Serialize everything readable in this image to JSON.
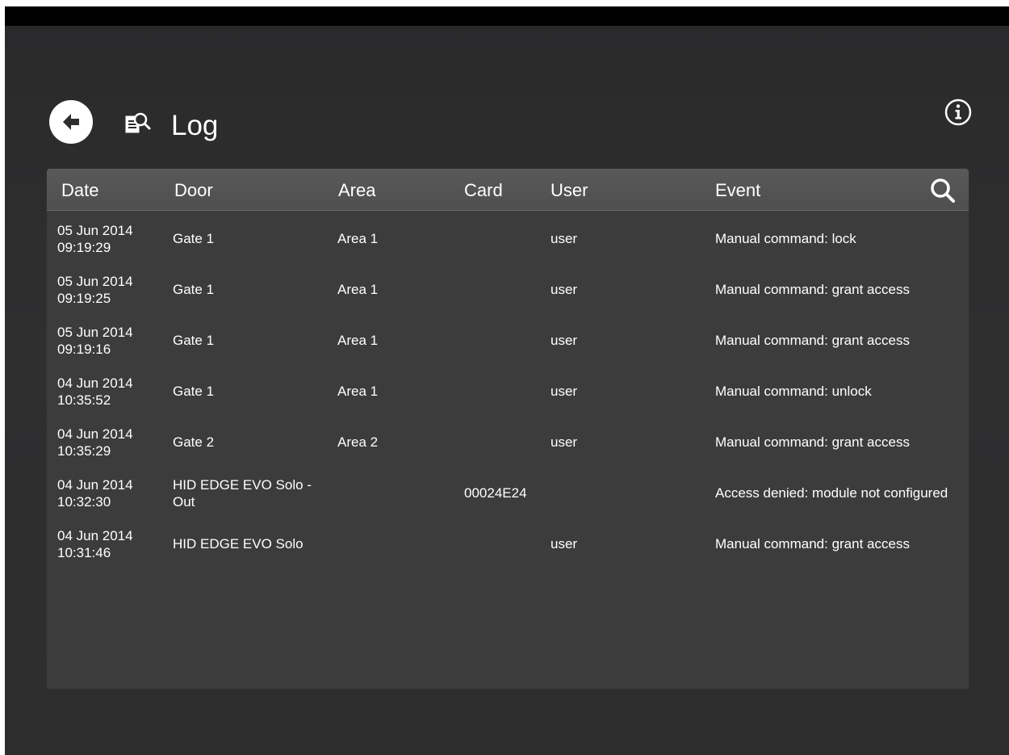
{
  "header": {
    "title": "Log",
    "icons": {
      "back": "back-arrow-icon",
      "log": "log-search-icon",
      "info": "info-icon",
      "search": "search-icon"
    }
  },
  "table": {
    "columns": [
      "Date",
      "Door",
      "Area",
      "Card",
      "User",
      "Event"
    ],
    "rows": [
      {
        "date": "05 Jun 2014",
        "time": "09:19:29",
        "door": "Gate 1",
        "area": "Area 1",
        "card": "",
        "user": "user",
        "event": "Manual command: lock"
      },
      {
        "date": "05 Jun 2014",
        "time": "09:19:25",
        "door": "Gate 1",
        "area": "Area 1",
        "card": "",
        "user": "user",
        "event": "Manual command: grant access"
      },
      {
        "date": "05 Jun 2014",
        "time": "09:19:16",
        "door": "Gate 1",
        "area": "Area 1",
        "card": "",
        "user": "user",
        "event": "Manual command: grant access"
      },
      {
        "date": "04 Jun 2014",
        "time": "10:35:52",
        "door": "Gate 1",
        "area": "Area 1",
        "card": "",
        "user": "user",
        "event": "Manual command: unlock"
      },
      {
        "date": "04 Jun 2014",
        "time": "10:35:29",
        "door": "Gate 2",
        "area": "Area 2",
        "card": "",
        "user": "user",
        "event": "Manual command: grant access"
      },
      {
        "date": "04 Jun 2014",
        "time": "10:32:30",
        "door": "HID EDGE EVO Solo - Out",
        "area": "",
        "card": "00024E24",
        "user": "",
        "event": "Access denied: module not configured"
      },
      {
        "date": "04 Jun 2014",
        "time": "10:31:46",
        "door": "HID EDGE EVO Solo",
        "area": "",
        "card": "",
        "user": "user",
        "event": "Manual command: grant access"
      }
    ]
  },
  "colors": {
    "background": "#2d2d2e",
    "panel": "#3c3c3d",
    "header": "#555556",
    "text": "#ffffff"
  }
}
